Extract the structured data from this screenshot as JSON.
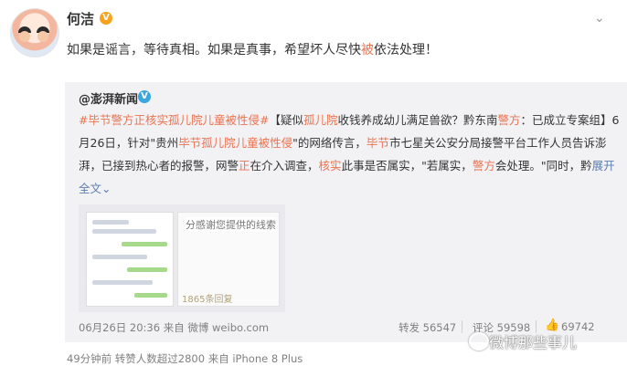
{
  "post": {
    "username": "何洁",
    "verified_badge": "V",
    "text_a": "如果是谣言，等待真相。如果是真事，希望坏人尽快",
    "text_hl": "被",
    "text_b": "依法处理！"
  },
  "quote": {
    "author": "@澎湃新闻",
    "verified_badge": "V",
    "l1_hashtag": "#毕节警方正核实孤儿院儿童被性侵#",
    "l1_a": "【疑似",
    "l1_hl1": "孤儿院",
    "l1_b": "收钱养成幼儿满足兽欲？黔东南",
    "l1_hl2": "警方",
    "l1_c": "：已成立专案组】6",
    "l2_a": "月26日，针对\"贵州",
    "l2_hl": "毕节孤儿院儿童被性侵",
    "l2_b": "\"的网络传言，",
    "l2_hl2": "毕节",
    "l2_c": "市七星关公安分局接警平台工作人员告诉澎",
    "l3_a": "湃，已接到热心者的报警，网警",
    "l3_hl": "正",
    "l3_b": "在介入调查，",
    "l3_hl2": "核实",
    "l3_c": "此事是否属实，\"若属实，",
    "l3_hl3": "警方",
    "l3_d": "会处理。\"同时，黔",
    "expand": "展开",
    "full_text": "全文",
    "full_text_chev": "⌄",
    "image_caption": "分感谢您提供的线索",
    "image_stamp": "1865条回复",
    "meta": "06月26日 20:36 来自 微博 weibo.com",
    "repost": "转发 56547",
    "comment": "评论 59598",
    "like": "69742"
  },
  "footer": {
    "meta": "49分钟前  转赞人数超过2800  来自 iPhone 8 Plus"
  },
  "watermark": "微博那些事儿",
  "colors": {
    "highlight": "#eb7350",
    "link": "#5b7eaf",
    "quote_bg": "#f2f2f5"
  }
}
